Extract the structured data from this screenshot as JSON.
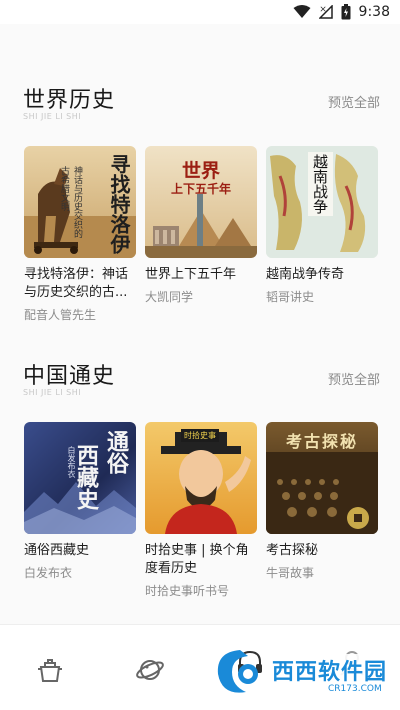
{
  "status_bar": {
    "time": "9:38"
  },
  "sections": [
    {
      "title": "世界历史",
      "subtitle": "SHI JIE LI SHI",
      "more": "预览全部",
      "items": [
        {
          "title": "寻找特洛伊：神话与历史交织的古...",
          "author": "配音人管先生",
          "cover_text": "寻找特洛伊",
          "cover_sub": "神话与历史交织的古希腊文明"
        },
        {
          "title": "世界上下五千年",
          "author": "大凯同学",
          "cover_text": "世界",
          "cover_sub": "上下五千年"
        },
        {
          "title": "越南战争传奇",
          "author": "韬哥讲史",
          "cover_text": "越南战争"
        }
      ]
    },
    {
      "title": "中国通史",
      "subtitle": "SHI JIE LI SHI",
      "more": "预览全部",
      "items": [
        {
          "title": "通俗西藏史",
          "author": "白发布衣",
          "cover_text_a": "通俗",
          "cover_text_b": "西藏史",
          "cover_small": "白发布衣"
        },
        {
          "title": "时拾史事 | 换个角度看历史",
          "author": "时拾史事听书号",
          "cover_badge": "时拾史事"
        },
        {
          "title": "考古探秘",
          "author": "牛哥故事",
          "cover_text": "考古探秘"
        }
      ]
    }
  ],
  "tabbar": {
    "icons": [
      "pot-icon",
      "planet-icon",
      "headphones-icon",
      "profile-icon"
    ]
  },
  "watermark": {
    "brand": "西西软件园",
    "url": "CR173.COM"
  }
}
